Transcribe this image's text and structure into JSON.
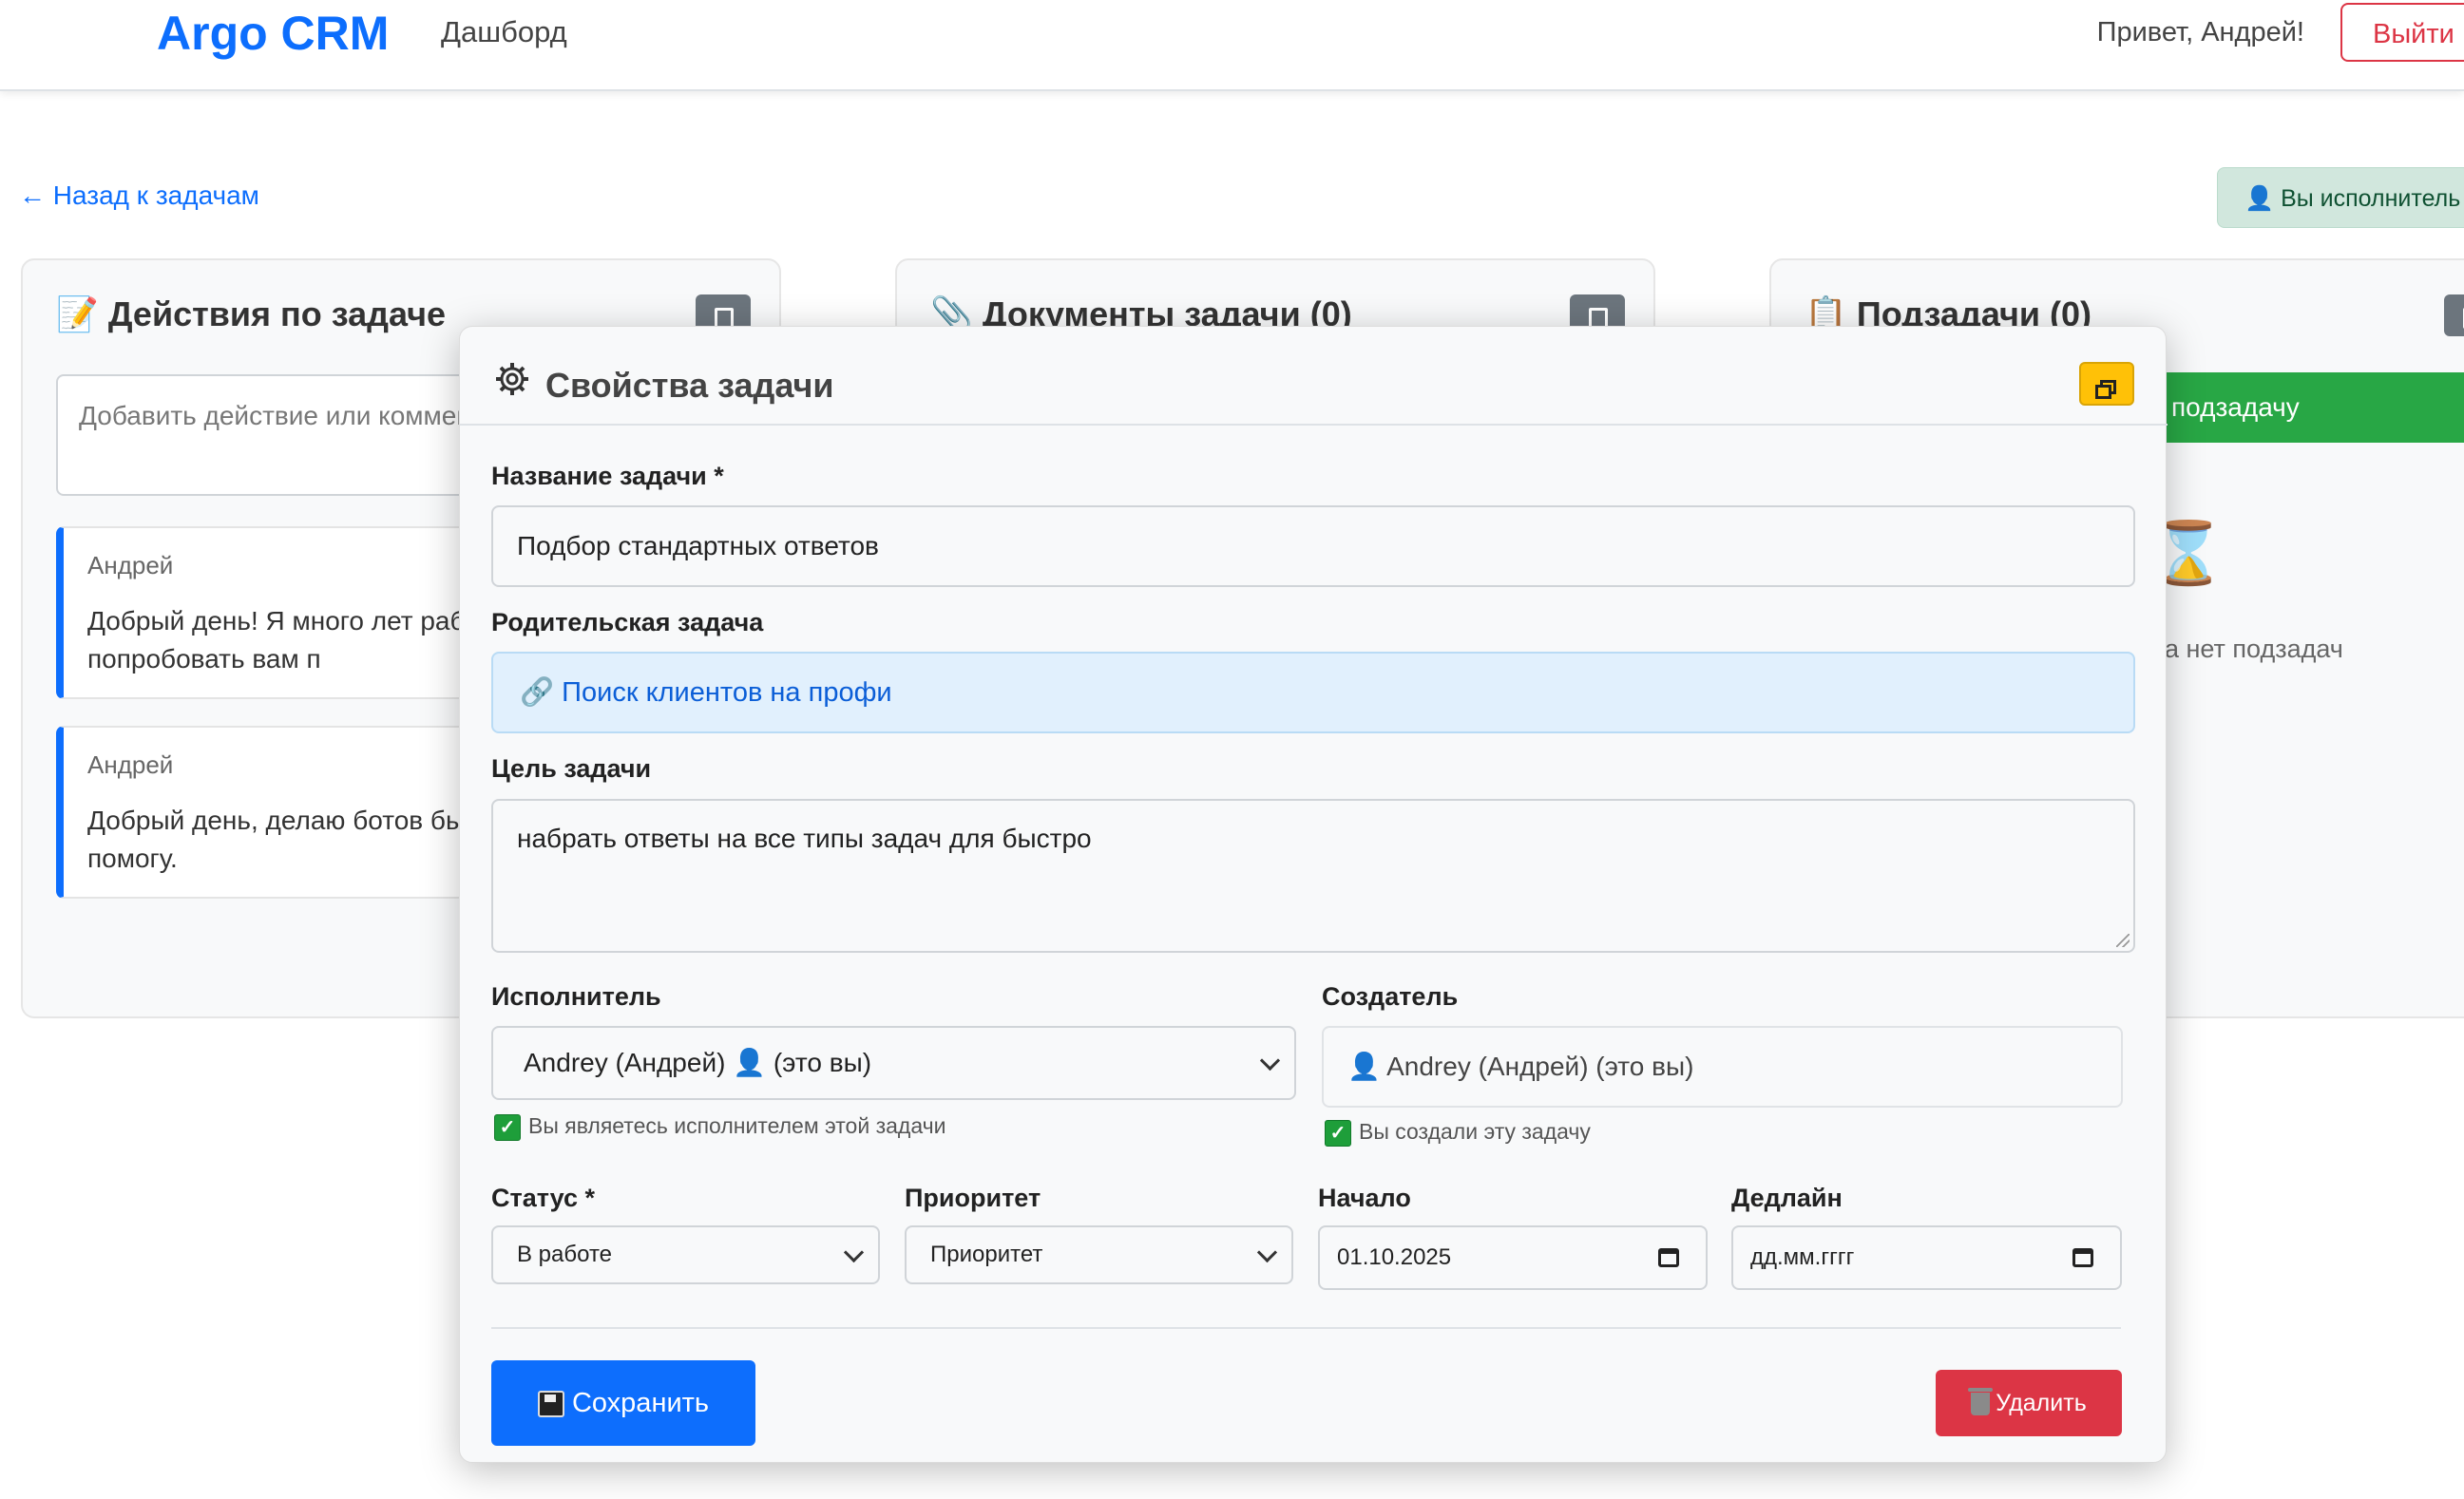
{
  "nav": {
    "brand": "Argo CRM",
    "dashboard_link": "Дашборд",
    "greeting": "Привет, Андрей!",
    "logout": "Выйти"
  },
  "page": {
    "back_link": "← Назад к задачам",
    "role_badge": "Вы исполнитель з",
    "actions_card": {
      "title": "Действия по задаче",
      "comment_placeholder": "Добавить действие или коммен",
      "comments": [
        {
          "author": "Андрей",
          "text": "Добрый день! Я много лет раб на C# могу попробовать вам п"
        },
        {
          "author": "Андрей",
          "text": "Добрый день, делаю ботов бы удовольствием помогу."
        }
      ]
    },
    "documents_card": {
      "title": "Документы задачи (0)"
    },
    "subtasks_card": {
      "title": "Подзадачи (0)",
      "add_button": "подзадачу",
      "empty_text": "а нет подзадач"
    }
  },
  "modal": {
    "title": "Свойства задачи",
    "name_label": "Название задачи *",
    "name_value": "Подбор стандартных ответов",
    "parent_label": "Родительская задача",
    "parent_value": "Поиск клиентов на профи",
    "goal_label": "Цель задачи",
    "goal_value": "набрать ответы на все типы задач для быстро",
    "assignee_label": "Исполнитель",
    "assignee_name": "Andrey (Андрей)",
    "assignee_suffix": "(это вы)",
    "assignee_hint": "Вы являетесь исполнителем этой задачи",
    "creator_label": "Создатель",
    "creator_value": "Andrey (Андрей) (это вы)",
    "creator_hint": "Вы создали эту задачу",
    "status_label": "Статус *",
    "status_value": "В работе",
    "priority_label": "Приоритет",
    "priority_value": "Приоритет",
    "start_label": "Начало",
    "start_value": "01.10.2025",
    "deadline_label": "Дедлайн",
    "deadline_placeholder": "дд.мм.гггг",
    "save_button": "Сохранить",
    "delete_button": "Удалить"
  }
}
